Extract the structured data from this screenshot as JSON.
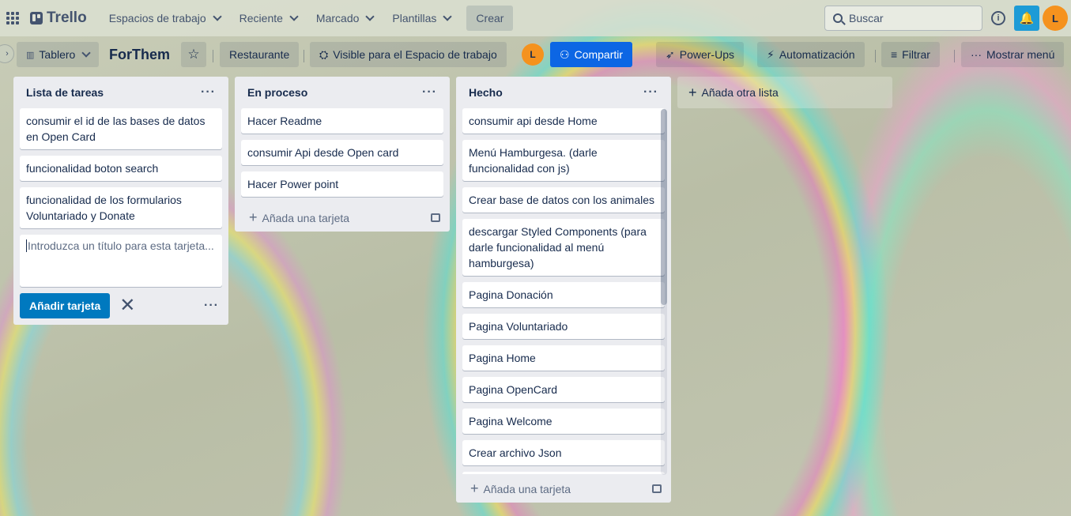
{
  "topnav": {
    "logo": "Trello",
    "items": [
      {
        "label": "Espacios de trabajo"
      },
      {
        "label": "Reciente"
      },
      {
        "label": "Marcado"
      },
      {
        "label": "Plantillas"
      }
    ],
    "create": "Crear",
    "search_placeholder": "Buscar",
    "info": "i",
    "bell": "🔔",
    "avatar": "L"
  },
  "board": {
    "view": "Tablero",
    "title": "ForThem",
    "star": "☆",
    "workspace": "Restaurante",
    "visibility": "Visible para el Espacio de trabajo",
    "avatar": "L",
    "share": "Compartir",
    "powerups": "Power-Ups",
    "automation": "Automatización",
    "filter": "Filtrar",
    "menu": "Mostrar menú"
  },
  "lists": [
    {
      "title": "Lista de tareas",
      "cards": [
        "consumir el id de las bases de datos en Open Card",
        "funcionalidad boton search",
        "funcionalidad de los formularios Voluntariado y Donate"
      ],
      "composer_placeholder": "Introduzca un título para esta tarjeta...",
      "composer_add": "Añadir tarjeta"
    },
    {
      "title": "En proceso",
      "cards": [
        "Hacer Readme",
        "consumir Api desde Open card",
        "Hacer Power point"
      ],
      "add_card": "Añada una tarjeta"
    },
    {
      "title": "Hecho",
      "cards": [
        "consumir api desde Home",
        "Menú Hamburgesa. (darle funcionalidad con js)",
        "Crear base de datos con los animales",
        "descargar Styled Components (para darle funcionalidad al menú hamburgesa)",
        "Pagina Donación",
        "Pagina Voluntariado",
        "Pagina Home",
        "Pagina OpenCard",
        "Pagina Welcome",
        "Crear archivo Json"
      ],
      "add_card": "Añada una tarjeta"
    }
  ],
  "add_list": "Añada otra lista",
  "colors": {
    "accent": "#0079bf",
    "share": "#0c66e4",
    "avatar": "#f5921e",
    "bell": "#1d9bd6"
  }
}
